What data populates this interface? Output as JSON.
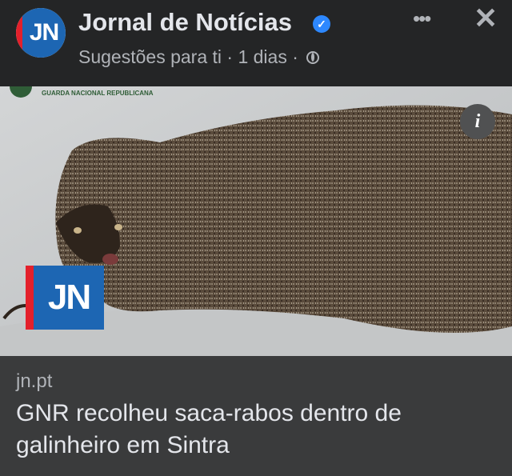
{
  "post": {
    "page_name": "Jornal de Notícias",
    "avatar_text": "JN",
    "subline": "Sugestões para ti · 1 dias ·",
    "more_icon": "more-horizontal-icon",
    "close_icon": "close-icon"
  },
  "image": {
    "overlay_badge": "JN",
    "watermark": "GUARDA NACIONAL REPUBLICANA",
    "info_icon": "i"
  },
  "link": {
    "domain": "jn.pt",
    "headline": "GNR recolheu saca-rabos dentro de galinheiro em Sintra"
  },
  "colors": {
    "background": "#242526",
    "link_background": "#3a3b3c",
    "verified": "#2d88ff",
    "jn_blue": "#1d66b3",
    "jn_red": "#e3202b"
  }
}
